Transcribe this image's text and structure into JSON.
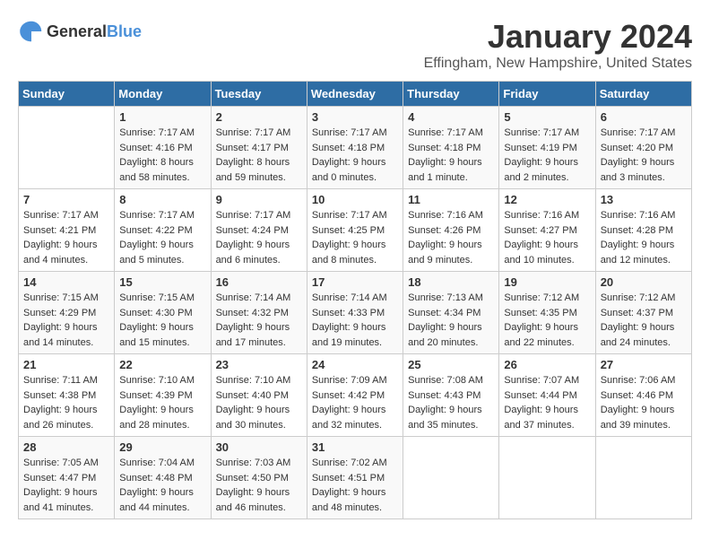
{
  "header": {
    "logo_general": "General",
    "logo_blue": "Blue",
    "title": "January 2024",
    "subtitle": "Effingham, New Hampshire, United States"
  },
  "days_of_week": [
    "Sunday",
    "Monday",
    "Tuesday",
    "Wednesday",
    "Thursday",
    "Friday",
    "Saturday"
  ],
  "weeks": [
    [
      {
        "day": "",
        "info": ""
      },
      {
        "day": "1",
        "info": "Sunrise: 7:17 AM\nSunset: 4:16 PM\nDaylight: 8 hours\nand 58 minutes."
      },
      {
        "day": "2",
        "info": "Sunrise: 7:17 AM\nSunset: 4:17 PM\nDaylight: 8 hours\nand 59 minutes."
      },
      {
        "day": "3",
        "info": "Sunrise: 7:17 AM\nSunset: 4:18 PM\nDaylight: 9 hours\nand 0 minutes."
      },
      {
        "day": "4",
        "info": "Sunrise: 7:17 AM\nSunset: 4:18 PM\nDaylight: 9 hours\nand 1 minute."
      },
      {
        "day": "5",
        "info": "Sunrise: 7:17 AM\nSunset: 4:19 PM\nDaylight: 9 hours\nand 2 minutes."
      },
      {
        "day": "6",
        "info": "Sunrise: 7:17 AM\nSunset: 4:20 PM\nDaylight: 9 hours\nand 3 minutes."
      }
    ],
    [
      {
        "day": "7",
        "info": "Sunrise: 7:17 AM\nSunset: 4:21 PM\nDaylight: 9 hours\nand 4 minutes."
      },
      {
        "day": "8",
        "info": "Sunrise: 7:17 AM\nSunset: 4:22 PM\nDaylight: 9 hours\nand 5 minutes."
      },
      {
        "day": "9",
        "info": "Sunrise: 7:17 AM\nSunset: 4:24 PM\nDaylight: 9 hours\nand 6 minutes."
      },
      {
        "day": "10",
        "info": "Sunrise: 7:17 AM\nSunset: 4:25 PM\nDaylight: 9 hours\nand 8 minutes."
      },
      {
        "day": "11",
        "info": "Sunrise: 7:16 AM\nSunset: 4:26 PM\nDaylight: 9 hours\nand 9 minutes."
      },
      {
        "day": "12",
        "info": "Sunrise: 7:16 AM\nSunset: 4:27 PM\nDaylight: 9 hours\nand 10 minutes."
      },
      {
        "day": "13",
        "info": "Sunrise: 7:16 AM\nSunset: 4:28 PM\nDaylight: 9 hours\nand 12 minutes."
      }
    ],
    [
      {
        "day": "14",
        "info": "Sunrise: 7:15 AM\nSunset: 4:29 PM\nDaylight: 9 hours\nand 14 minutes."
      },
      {
        "day": "15",
        "info": "Sunrise: 7:15 AM\nSunset: 4:30 PM\nDaylight: 9 hours\nand 15 minutes."
      },
      {
        "day": "16",
        "info": "Sunrise: 7:14 AM\nSunset: 4:32 PM\nDaylight: 9 hours\nand 17 minutes."
      },
      {
        "day": "17",
        "info": "Sunrise: 7:14 AM\nSunset: 4:33 PM\nDaylight: 9 hours\nand 19 minutes."
      },
      {
        "day": "18",
        "info": "Sunrise: 7:13 AM\nSunset: 4:34 PM\nDaylight: 9 hours\nand 20 minutes."
      },
      {
        "day": "19",
        "info": "Sunrise: 7:12 AM\nSunset: 4:35 PM\nDaylight: 9 hours\nand 22 minutes."
      },
      {
        "day": "20",
        "info": "Sunrise: 7:12 AM\nSunset: 4:37 PM\nDaylight: 9 hours\nand 24 minutes."
      }
    ],
    [
      {
        "day": "21",
        "info": "Sunrise: 7:11 AM\nSunset: 4:38 PM\nDaylight: 9 hours\nand 26 minutes."
      },
      {
        "day": "22",
        "info": "Sunrise: 7:10 AM\nSunset: 4:39 PM\nDaylight: 9 hours\nand 28 minutes."
      },
      {
        "day": "23",
        "info": "Sunrise: 7:10 AM\nSunset: 4:40 PM\nDaylight: 9 hours\nand 30 minutes."
      },
      {
        "day": "24",
        "info": "Sunrise: 7:09 AM\nSunset: 4:42 PM\nDaylight: 9 hours\nand 32 minutes."
      },
      {
        "day": "25",
        "info": "Sunrise: 7:08 AM\nSunset: 4:43 PM\nDaylight: 9 hours\nand 35 minutes."
      },
      {
        "day": "26",
        "info": "Sunrise: 7:07 AM\nSunset: 4:44 PM\nDaylight: 9 hours\nand 37 minutes."
      },
      {
        "day": "27",
        "info": "Sunrise: 7:06 AM\nSunset: 4:46 PM\nDaylight: 9 hours\nand 39 minutes."
      }
    ],
    [
      {
        "day": "28",
        "info": "Sunrise: 7:05 AM\nSunset: 4:47 PM\nDaylight: 9 hours\nand 41 minutes."
      },
      {
        "day": "29",
        "info": "Sunrise: 7:04 AM\nSunset: 4:48 PM\nDaylight: 9 hours\nand 44 minutes."
      },
      {
        "day": "30",
        "info": "Sunrise: 7:03 AM\nSunset: 4:50 PM\nDaylight: 9 hours\nand 46 minutes."
      },
      {
        "day": "31",
        "info": "Sunrise: 7:02 AM\nSunset: 4:51 PM\nDaylight: 9 hours\nand 48 minutes."
      },
      {
        "day": "",
        "info": ""
      },
      {
        "day": "",
        "info": ""
      },
      {
        "day": "",
        "info": ""
      }
    ]
  ]
}
